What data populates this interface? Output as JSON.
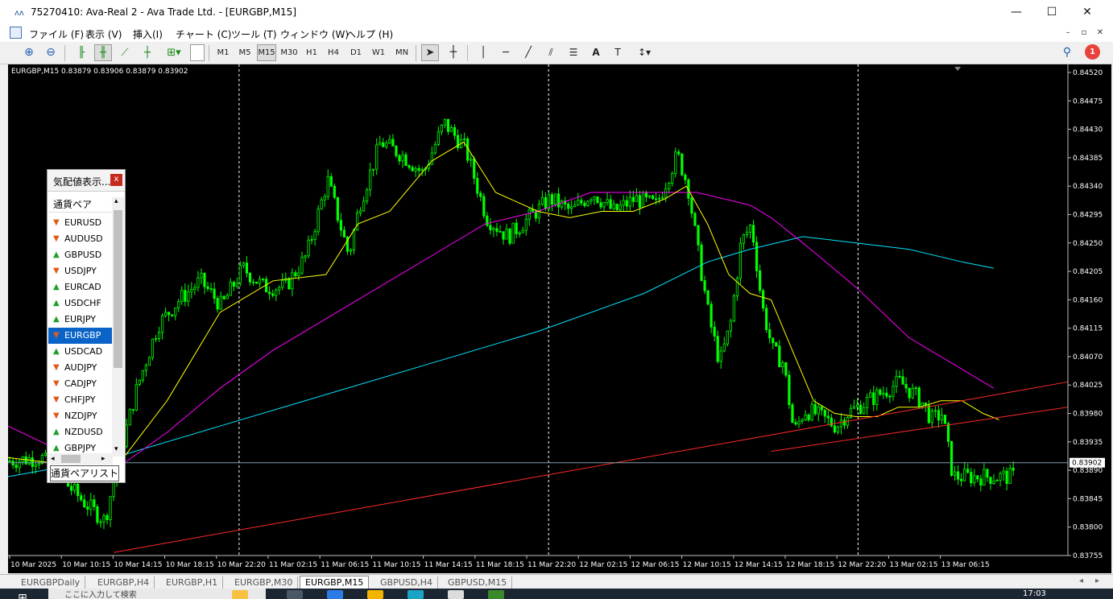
{
  "window": {
    "title": "75270410: Ava-Real 2 - Ava Trade Ltd. - [EURGBP,M15]",
    "minimize": "—",
    "maximize": "☐",
    "close": "✕"
  },
  "menu": [
    "ファイル (F)",
    "表示 (V)",
    "挿入(I)",
    "チャート (C)",
    "ツール (T)",
    "ウィンドウ (W)",
    "ヘルプ (H)"
  ],
  "toolbar": {
    "timeframes": [
      "M1",
      "M5",
      "M15",
      "M30",
      "H1",
      "H4",
      "D1",
      "W1",
      "MN"
    ],
    "active_timeframe": "M15",
    "notification_count": "1"
  },
  "chart": {
    "header": "EURGBP,M15  0.83879 0.83906 0.83879 0.83902",
    "current_price": "0.83902",
    "colors": {
      "candle": "#00ff00",
      "ma_fast": "#ffff00",
      "ma_mid": "#ff00ff",
      "ma_slow": "#00e5ff",
      "trendline": "#ff2a2a"
    }
  },
  "chart_data": {
    "type": "line",
    "title": "EURGBP,M15",
    "symbol": "EURGBP",
    "timeframe": "M15",
    "ohlc_header": [
      0.83879,
      0.83906,
      0.83879,
      0.83902
    ],
    "y_ticks": [
      "0.84520",
      "0.84475",
      "0.84430",
      "0.84385",
      "0.84340",
      "0.84295",
      "0.84250",
      "0.84205",
      "0.84160",
      "0.84115",
      "0.84070",
      "0.84025",
      "0.83980",
      "0.83935",
      "0.83890",
      "0.83845",
      "0.83800",
      "0.83755"
    ],
    "x_ticks": [
      "10 Mar 2025",
      "10 Mar 10:15",
      "10 Mar 14:15",
      "10 Mar 18:15",
      "10 Mar 22:20",
      "11 Mar 02:15",
      "11 Mar 06:15",
      "11 Mar 10:15",
      "11 Mar 14:15",
      "11 Mar 18:15",
      "11 Mar 22:20",
      "12 Mar 02:15",
      "12 Mar 06:15",
      "12 Mar 10:15",
      "12 Mar 14:15",
      "12 Mar 18:15",
      "12 Mar 22:20",
      "13 Mar 02:15",
      "13 Mar 06:15"
    ],
    "ylim": [
      0.83755,
      0.8452
    ],
    "grid": false,
    "price_path_x": [
      0,
      0.03,
      0.07,
      0.09,
      0.1,
      0.12,
      0.14,
      0.16,
      0.18,
      0.2,
      0.22,
      0.24,
      0.26,
      0.28,
      0.3,
      0.32,
      0.33,
      0.35,
      0.37,
      0.39,
      0.41,
      0.43,
      0.45,
      0.47,
      0.49,
      0.51,
      0.53,
      0.55,
      0.57,
      0.59,
      0.61,
      0.63,
      0.64,
      0.65,
      0.66,
      0.67,
      0.68,
      0.69,
      0.7,
      0.71,
      0.72,
      0.73,
      0.74,
      0.75,
      0.76,
      0.77,
      0.78,
      0.79,
      0.8,
      0.82,
      0.84,
      0.86,
      0.87,
      0.88,
      0.89,
      0.9,
      0.91,
      0.92,
      0.93,
      0.94,
      0.95
    ],
    "price_path": [
      0.83905,
      0.8391,
      0.8384,
      0.8381,
      0.8389,
      0.8402,
      0.8412,
      0.8416,
      0.8419,
      0.8415,
      0.8421,
      0.8418,
      0.8418,
      0.8423,
      0.8435,
      0.8423,
      0.8431,
      0.8441,
      0.8439,
      0.8436,
      0.8444,
      0.844,
      0.8429,
      0.8426,
      0.8429,
      0.8432,
      0.843,
      0.8433,
      0.843,
      0.8432,
      0.8431,
      0.8439,
      0.8434,
      0.8423,
      0.8413,
      0.8406,
      0.8412,
      0.8425,
      0.8428,
      0.8415,
      0.8408,
      0.8406,
      0.8395,
      0.83985,
      0.8398,
      0.8397,
      0.8396,
      0.8398,
      0.8399,
      0.8401,
      0.8403,
      0.84,
      0.8397,
      0.8398,
      0.8388,
      0.8388,
      0.8388,
      0.8388,
      0.8388,
      0.8388,
      0.8388
    ],
    "ma_fast_x": [
      0,
      0.05,
      0.1,
      0.15,
      0.2,
      0.25,
      0.3,
      0.33,
      0.36,
      0.4,
      0.43,
      0.46,
      0.5,
      0.53,
      0.56,
      0.59,
      0.62,
      0.64,
      0.66,
      0.68,
      0.7,
      0.72,
      0.74,
      0.76,
      0.78,
      0.8,
      0.82,
      0.84,
      0.86,
      0.88,
      0.9,
      0.92,
      0.935
    ],
    "ma_fast": [
      0.8391,
      0.839,
      0.8389,
      0.84,
      0.8414,
      0.8419,
      0.842,
      0.8428,
      0.843,
      0.8438,
      0.8441,
      0.8433,
      0.843,
      0.8429,
      0.843,
      0.843,
      0.8432,
      0.8434,
      0.8428,
      0.842,
      0.8417,
      0.8416,
      0.8408,
      0.84,
      0.8398,
      0.83975,
      0.83975,
      0.8399,
      0.8399,
      0.84,
      0.84,
      0.8398,
      0.8397
    ],
    "ma_mid_x": [
      0,
      0.05,
      0.1,
      0.15,
      0.2,
      0.25,
      0.3,
      0.35,
      0.4,
      0.45,
      0.5,
      0.55,
      0.6,
      0.65,
      0.7,
      0.72,
      0.75,
      0.8,
      0.85,
      0.9,
      0.93
    ],
    "ma_mid": [
      0.8396,
      0.8392,
      0.8389,
      0.8395,
      0.8402,
      0.8408,
      0.8413,
      0.8418,
      0.8423,
      0.8428,
      0.843,
      0.8433,
      0.8433,
      0.8433,
      0.8431,
      0.8429,
      0.8425,
      0.8418,
      0.841,
      0.8405,
      0.8402
    ],
    "ma_slow_x": [
      0,
      0.1,
      0.2,
      0.3,
      0.4,
      0.5,
      0.6,
      0.66,
      0.7,
      0.75,
      0.8,
      0.85,
      0.9,
      0.93
    ],
    "ma_slow": [
      0.8388,
      0.8391,
      0.8396,
      0.8401,
      0.8406,
      0.8411,
      0.8417,
      0.8422,
      0.8424,
      0.8426,
      0.8425,
      0.8424,
      0.8422,
      0.8421
    ],
    "trendlines": [
      {
        "x": [
          0.1,
          1.0
        ],
        "y": [
          0.8376,
          0.8403
        ]
      },
      {
        "x": [
          0.72,
          1.0
        ],
        "y": [
          0.8392,
          0.8399
        ]
      }
    ]
  },
  "market_watch": {
    "title": "気配値表示...",
    "close": "x",
    "column": "通貨ペア",
    "symbols": [
      {
        "name": "EURUSD",
        "dir": "down"
      },
      {
        "name": "AUDUSD",
        "dir": "down"
      },
      {
        "name": "GBPUSD",
        "dir": "up"
      },
      {
        "name": "USDJPY",
        "dir": "down"
      },
      {
        "name": "EURCAD",
        "dir": "up"
      },
      {
        "name": "USDCHF",
        "dir": "up"
      },
      {
        "name": "EURJPY",
        "dir": "up"
      },
      {
        "name": "EURGBP",
        "dir": "down",
        "selected": true
      },
      {
        "name": "USDCAD",
        "dir": "up"
      },
      {
        "name": "AUDJPY",
        "dir": "down"
      },
      {
        "name": "CADJPY",
        "dir": "down"
      },
      {
        "name": "CHFJPY",
        "dir": "down"
      },
      {
        "name": "NZDJPY",
        "dir": "down"
      },
      {
        "name": "NZDUSD",
        "dir": "up"
      },
      {
        "name": "GBPJPY",
        "dir": "up"
      }
    ],
    "tab": "通貨ペアリスト"
  },
  "chart_tabs": [
    "EURGBPDaily",
    "EURGBP,H4",
    "EURGBP,H1",
    "EURGBP,M30",
    "EURGBP,M15",
    "GBPUSD,H4",
    "GBPUSD,M15"
  ],
  "active_chart_tab": "EURGBP,M15",
  "taskbar": {
    "search_placeholder": "ここに入力して検索",
    "time": "17:03"
  }
}
